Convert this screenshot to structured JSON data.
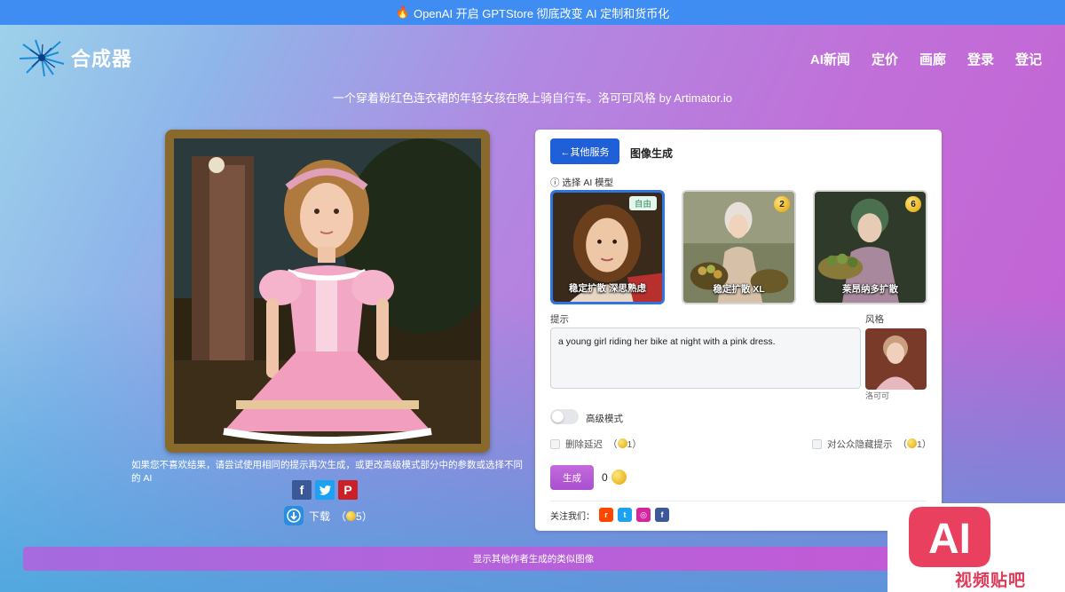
{
  "announcement": {
    "icon": "fire-icon",
    "text": "OpenAI 开启 GPTStore 彻底改变 AI 定制和货币化"
  },
  "brand": {
    "logo_icon": "starburst-logo-icon",
    "name": "合成器"
  },
  "nav": [
    "AI新闻",
    "定价",
    "画廊",
    "登录",
    "登记"
  ],
  "image_caption": "一个穿着粉红色连衣裙的年轻女孩在晚上骑自行车。洛可可风格 by Artimator.io",
  "left_panel": {
    "hint": "如果您不喜欢结果，请尝试使用相同的提示再次生成，或更改高级模式部分中的参数或选择不同的 AI",
    "share_icons": [
      "facebook-icon",
      "twitter-icon",
      "pinterest-icon"
    ],
    "download_label": "下载",
    "download_cost": "5"
  },
  "card": {
    "back_label": "←其他服务",
    "title": "图像生成",
    "model_label": "选择 AI 模型",
    "models": [
      {
        "name": "稳定扩散 深思熟虑",
        "badge": "自由",
        "selected": true
      },
      {
        "name": "稳定扩散 XL",
        "badge": "2",
        "selected": false
      },
      {
        "name": "莱昂纳多扩散",
        "badge": "6",
        "selected": false
      }
    ],
    "prompt_label": "提示",
    "prompt_value": "a young girl riding her bike at night with a pink dress.",
    "style_label": "风格",
    "style_name": "洛可可",
    "advanced_label": "高级模式",
    "advanced_on": false,
    "delete_delay_label": "删除延迟",
    "delete_delay_cost": "1",
    "hide_prompt_label": "对公众隐藏提示",
    "hide_prompt_cost": "1",
    "generate_label": "生成",
    "generate_cost": "0",
    "follow_label": "关注我们：",
    "follow_icons": [
      "reddit-icon",
      "twitter-icon",
      "instagram-icon",
      "facebook-icon"
    ]
  },
  "more_button": "显示其他作者生成的类似图像",
  "watermark": {
    "logo": "AI",
    "text": "视频贴吧"
  },
  "colors": {
    "primary": "#1f5fd8",
    "generate": "#b85ad6",
    "announce": "#3f8df3"
  }
}
